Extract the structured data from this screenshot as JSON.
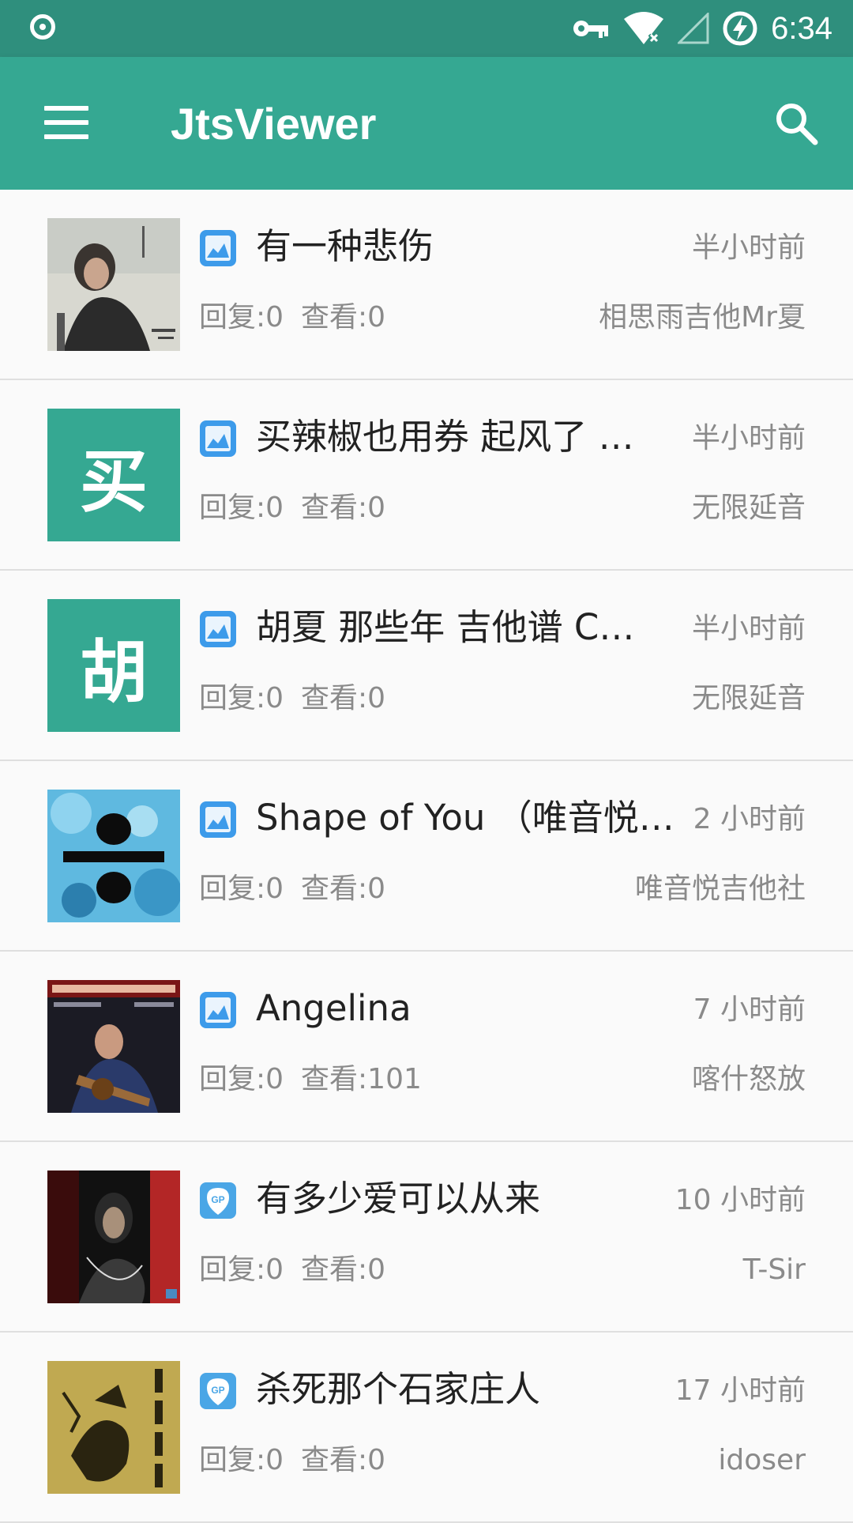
{
  "status_bar": {
    "time": "6:34",
    "icons": [
      "record-icon",
      "vpn-key-icon",
      "wifi-off-icon",
      "signal-icon",
      "battery-charging-icon"
    ]
  },
  "app_bar": {
    "title": "JtsViewer",
    "menu_icon": "menu-icon",
    "search_icon": "search-icon"
  },
  "colors": {
    "status_bar": "#2f8f7d",
    "app_bar": "#35a892",
    "accent": "#35a892",
    "tab_icon_blue": "#3d9bea"
  },
  "items": [
    {
      "title": "有一种悲伤",
      "time": "半小时前",
      "replies": "回复:0",
      "views": "查看:0",
      "author": "相思雨吉他Mr夏",
      "thumb": "photo",
      "type_icon": "image-icon"
    },
    {
      "title": "买辣椒也用券 起风了 …",
      "time": "半小时前",
      "replies": "回复:0",
      "views": "查看:0",
      "author": "无限延音",
      "thumb_letter": "买",
      "type_icon": "image-icon"
    },
    {
      "title": "胡夏 那些年 吉他谱 C…",
      "time": "半小时前",
      "replies": "回复:0",
      "views": "查看:0",
      "author": "无限延音",
      "thumb_letter": "胡",
      "type_icon": "image-icon"
    },
    {
      "title": "Shape of You （唯音悦…",
      "time": "2 小时前",
      "replies": "回复:0",
      "views": "查看:0",
      "author": "唯音悦吉他社",
      "thumb": "photo",
      "type_icon": "image-icon"
    },
    {
      "title": "Angelina",
      "time": "7 小时前",
      "replies": "回复:0",
      "views": "查看:101",
      "author": "喀什怒放",
      "thumb": "photo",
      "type_icon": "image-icon"
    },
    {
      "title": "有多少爱可以从来",
      "time": "10 小时前",
      "replies": "回复:0",
      "views": "查看:0",
      "author": "T-Sir",
      "thumb": "photo",
      "type_icon": "guitar-pro-icon"
    },
    {
      "title": "杀死那个石家庄人",
      "time": "17 小时前",
      "replies": "回复:0",
      "views": "查看:0",
      "author": "idoser",
      "thumb": "photo",
      "type_icon": "guitar-pro-icon"
    }
  ]
}
